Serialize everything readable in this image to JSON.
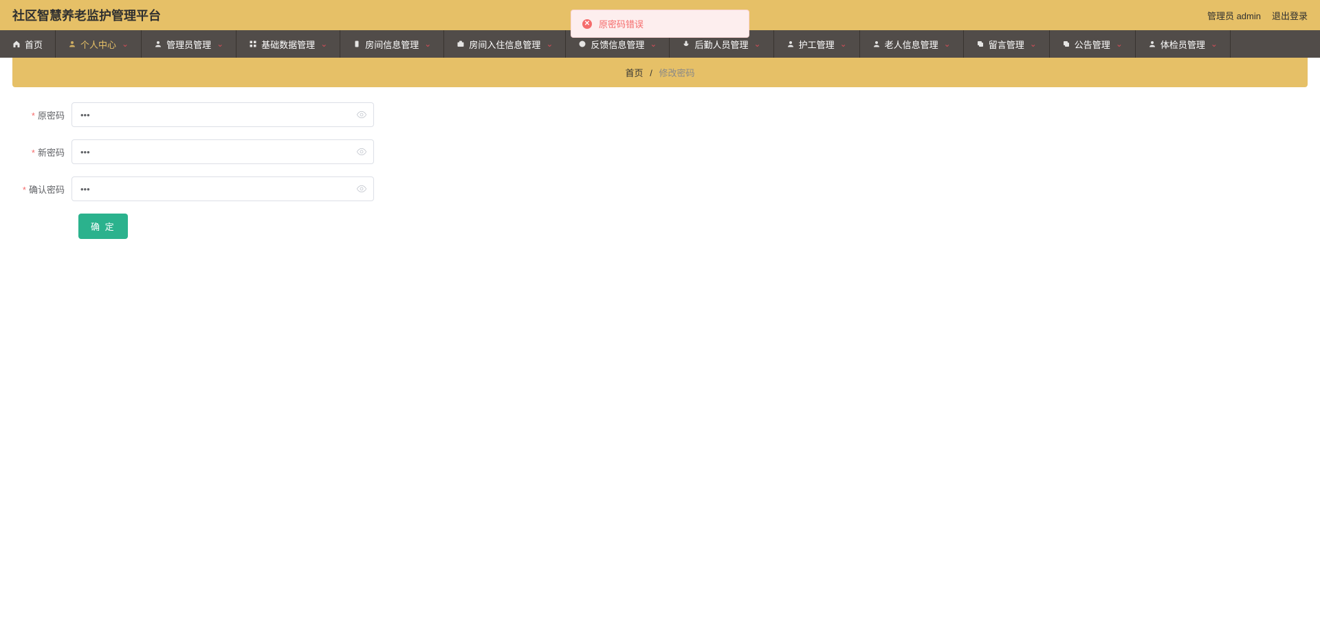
{
  "header": {
    "title": "社区智慧养老监护管理平台",
    "admin_label": "管理员 admin",
    "logout_label": "退出登录"
  },
  "toast": {
    "text": "原密码错误"
  },
  "nav": {
    "items": [
      {
        "label": "首页",
        "icon": "home"
      },
      {
        "label": "个人中心",
        "icon": "user",
        "active": true
      },
      {
        "label": "管理员管理",
        "icon": "user"
      },
      {
        "label": "基础数据管理",
        "icon": "grid"
      },
      {
        "label": "房间信息管理",
        "icon": "device"
      },
      {
        "label": "房间入住信息管理",
        "icon": "case"
      },
      {
        "label": "反馈信息管理",
        "icon": "info"
      },
      {
        "label": "后勤人员管理",
        "icon": "mic"
      },
      {
        "label": "护工管理",
        "icon": "user"
      },
      {
        "label": "老人信息管理",
        "icon": "user"
      },
      {
        "label": "留言管理",
        "icon": "copy"
      },
      {
        "label": "公告管理",
        "icon": "copy"
      },
      {
        "label": "体检员管理",
        "icon": "user"
      }
    ]
  },
  "breadcrumb": {
    "home": "首页",
    "current": "修改密码"
  },
  "form": {
    "old_label": "原密码",
    "new_label": "新密码",
    "confirm_label": "确认密码",
    "old_value": "•••",
    "new_value": "•••",
    "confirm_value": "•••",
    "submit": "确 定"
  }
}
